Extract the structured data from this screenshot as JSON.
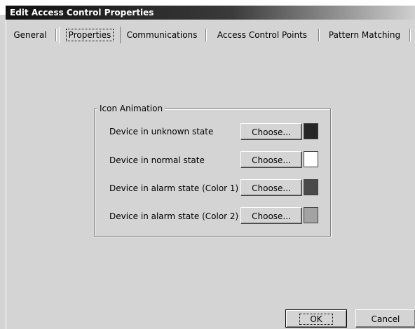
{
  "window": {
    "title": "Edit Access Control Properties"
  },
  "tabs": [
    {
      "label": "General"
    },
    {
      "label": "Properties"
    },
    {
      "label": "Communications"
    },
    {
      "label": "Access Control Points"
    },
    {
      "label": "Pattern Matching"
    }
  ],
  "active_tab": "Properties",
  "group": {
    "label": "Icon Animation",
    "rows": [
      {
        "label": "Device in unknown state",
        "button": "Choose...",
        "color": "#262626"
      },
      {
        "label": "Device in normal state",
        "button": "Choose...",
        "color": "#ffffff"
      },
      {
        "label": "Device in alarm state (Color 1)",
        "button": "Choose...",
        "color": "#4a4a4a"
      },
      {
        "label": "Device in alarm state (Color 2)",
        "button": "Choose...",
        "color": "#a3a3a3"
      }
    ]
  },
  "buttons": {
    "ok": "OK",
    "cancel": "Cancel"
  }
}
